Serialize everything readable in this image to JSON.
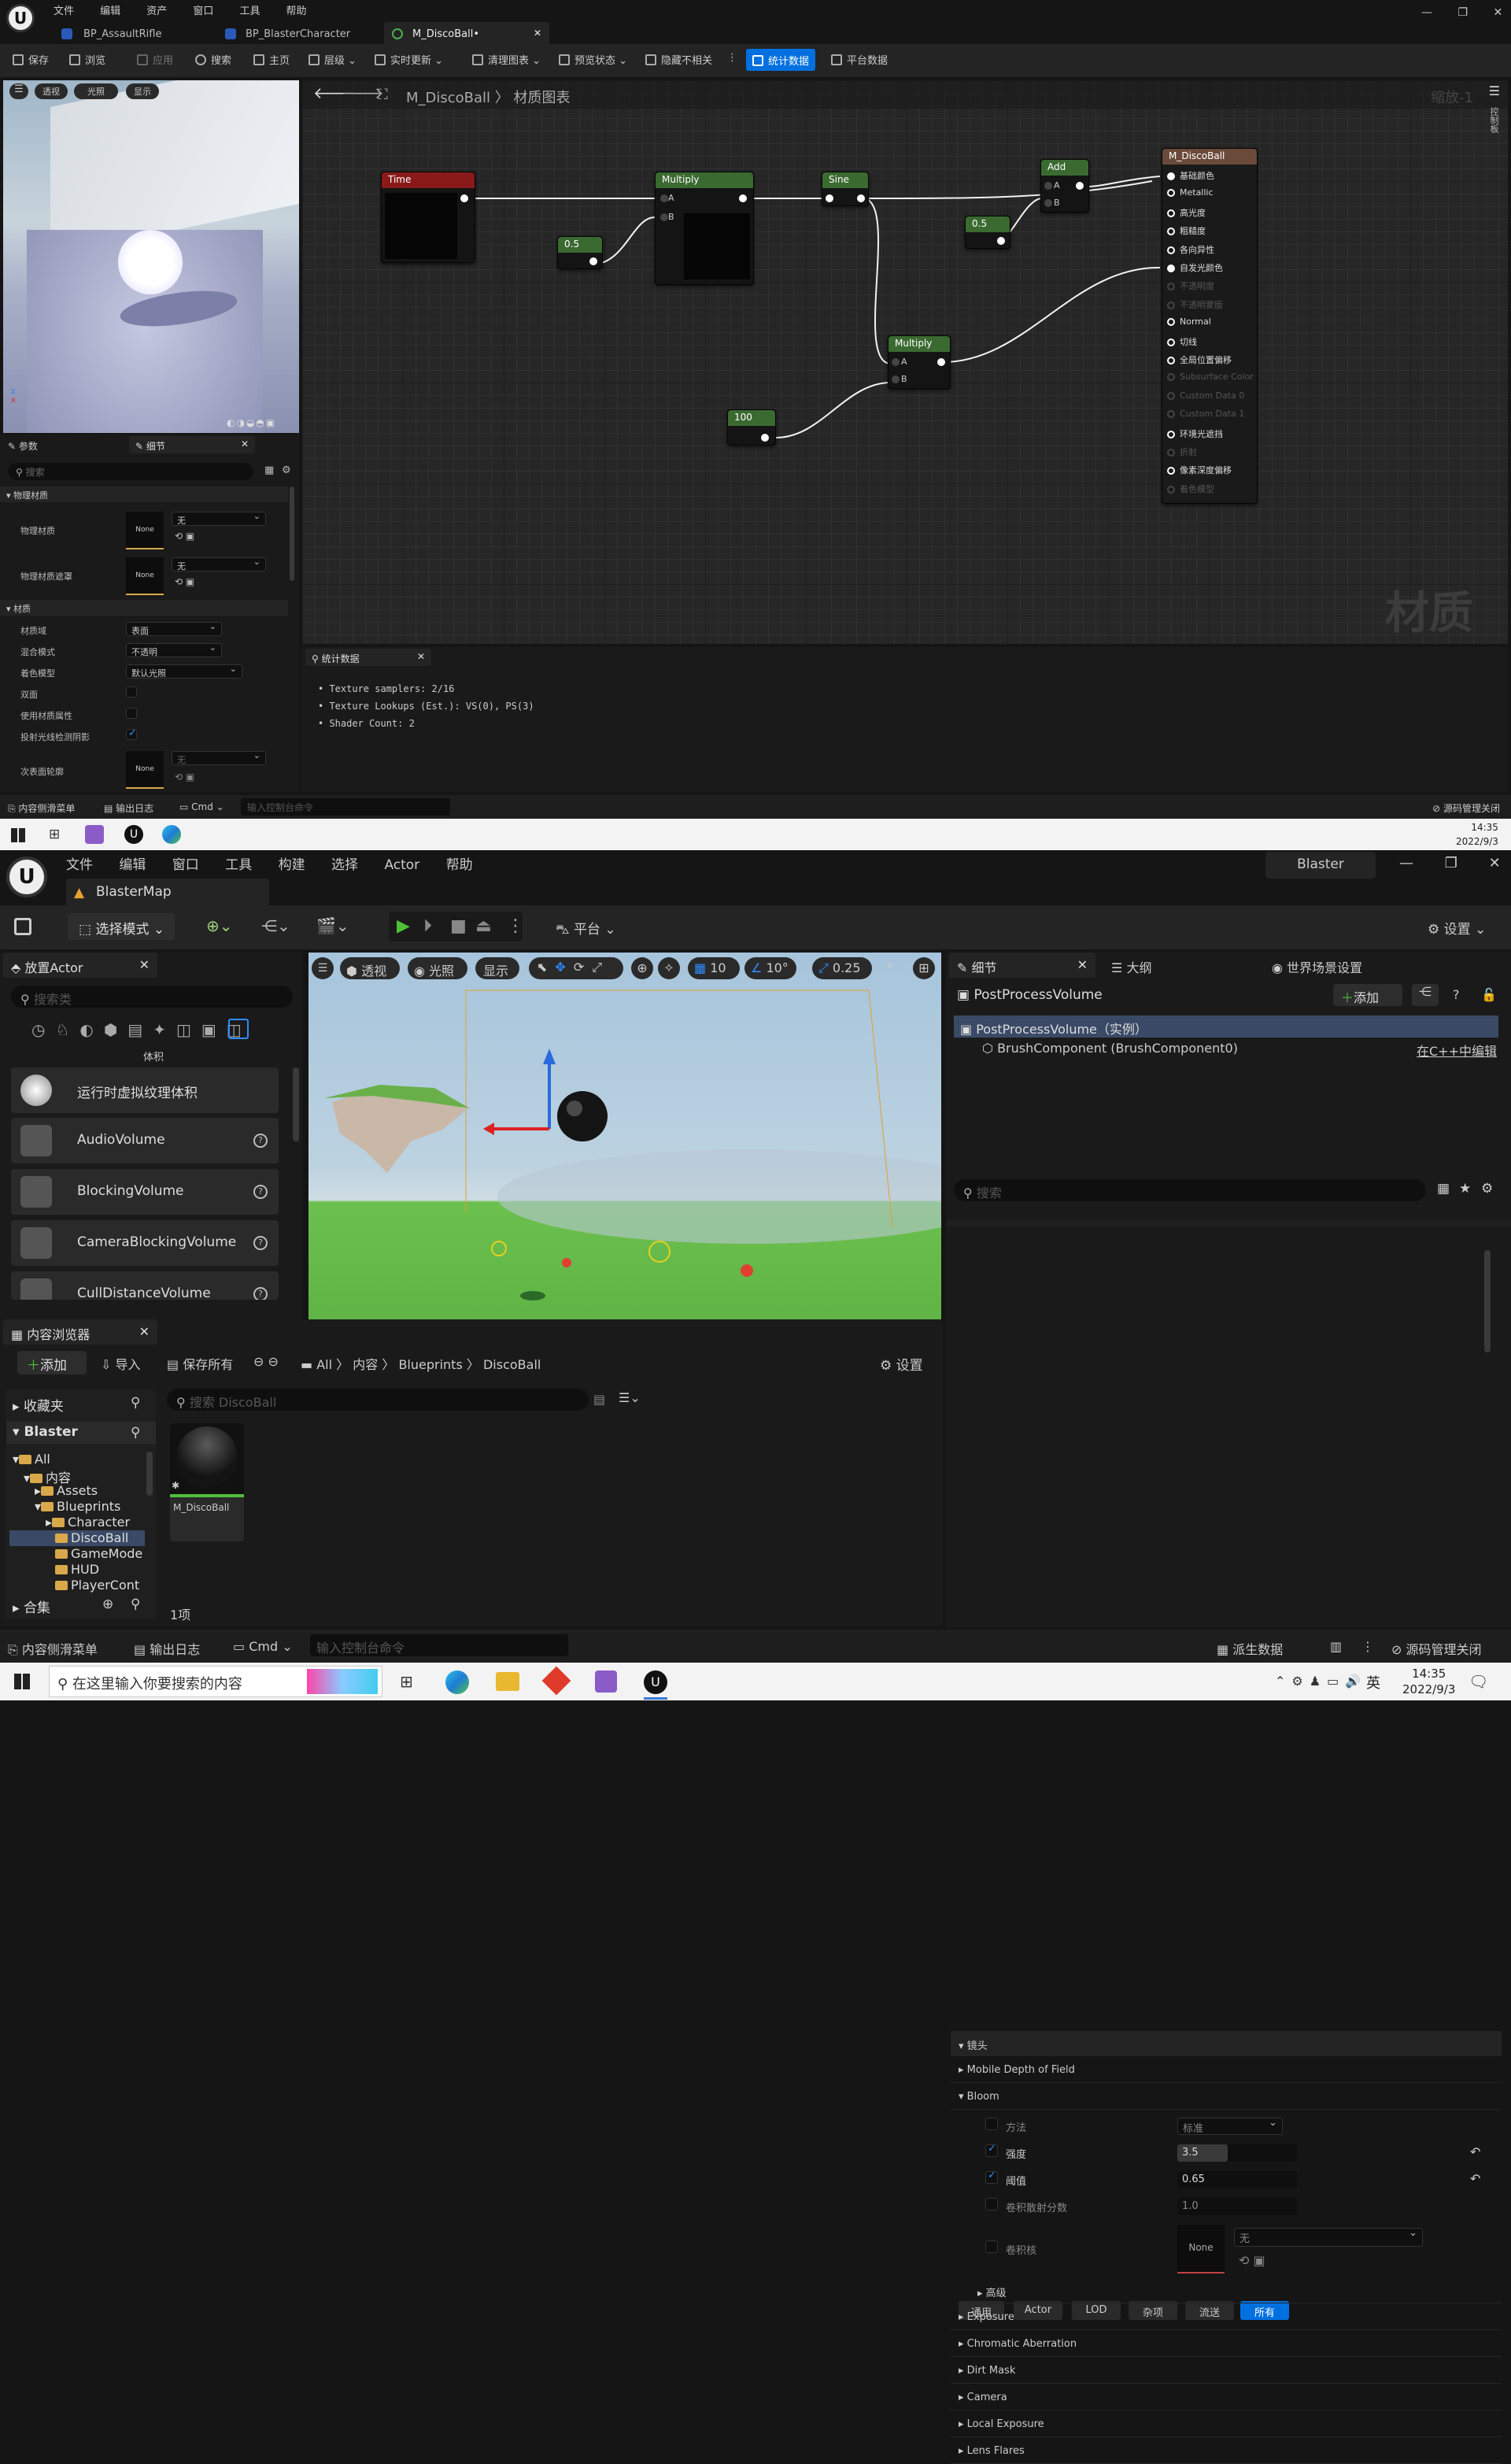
{
  "top": {
    "menu": [
      "文件",
      "编辑",
      "资产",
      "窗口",
      "工具",
      "帮助"
    ],
    "tabs": [
      "BP_AssaultRifle",
      "BP_BlasterCharacter",
      "M_DiscoBall•"
    ],
    "toolbar": [
      "保存",
      "浏览",
      "应用",
      "搜索",
      "主页",
      "层级",
      "实时更新",
      "清理图表",
      "预览状态",
      "隐藏不相关",
      "统计数据",
      "平台数据"
    ],
    "viewport_buttons": [
      "透视",
      "光照",
      "显示"
    ],
    "breadcrumb": {
      "asset": "M_DiscoBall",
      "graph": "材质图表"
    },
    "zoom": "缩放-1",
    "side_label": "控制板",
    "watermark": "材质",
    "nodes": {
      "time": "Time",
      "multiply1": "Multiply",
      "sine": "Sine",
      "add": "Add",
      "const1": "0.5",
      "const2": "0.5",
      "const3": "100",
      "multiply2": "Multiply",
      "pin_a": "A",
      "pin_b": "B",
      "result": "M_DiscoBall",
      "result_pins": [
        "基础颜色",
        "Metallic",
        "高光度",
        "粗糙度",
        "各向异性",
        "自发光颜色",
        "不透明度",
        "不透明蒙版",
        "Normal",
        "切线",
        "全局位置偏移",
        "Subsurface Color",
        "Custom Data 0",
        "Custom Data 1",
        "环境光遮挡",
        "折射",
        "像素深度偏移",
        "着色模型"
      ]
    },
    "details": {
      "tabs": [
        "参数",
        "细节"
      ],
      "search_placeholder": "搜索",
      "section_physical": "物理材质",
      "phys_material": "物理材质",
      "phys_mask": "物理材质遮罩",
      "none": "None",
      "combo_none": "无",
      "section_material": "材质",
      "material_domain": "材质域",
      "material_domain_value": "表面",
      "blend_mode": "混合模式",
      "blend_mode_value": "不透明",
      "shading_model": "着色模型",
      "shading_model_value": "默认光照",
      "two_sided": "双面",
      "use_material_attributes": "使用材质属性",
      "cast_ray_traced_shadows": "投射光线检测阴影",
      "subsurface_profile": "次表面轮廓"
    },
    "stats": {
      "tab": "统计数据",
      "lines": [
        "Texture samplers: 2/16",
        "Texture Lookups (Est.): VS(0), PS(3)",
        "Shader Count: 2"
      ]
    },
    "statusbar": {
      "content_drawer": "内容侧滑菜单",
      "output_log": "输出日志",
      "cmd": "Cmd",
      "console_placeholder": "输入控制台命令",
      "source_control": "源码管理关闭"
    }
  },
  "taskbar1": {
    "time": "14:35",
    "date": "2022/9/3"
  },
  "bottom": {
    "menu": [
      "文件",
      "编辑",
      "窗口",
      "工具",
      "构建",
      "选择",
      "Actor",
      "帮助"
    ],
    "project": "Blaster",
    "map_tab": "BlasterMap",
    "select_mode": "选择模式",
    "platform": "平台",
    "settings": "设置",
    "place_actor": {
      "tab": "放置Actor",
      "search_placeholder": "搜索类",
      "category": "体积",
      "items": [
        "运行时虚拟纹理体积",
        "AudioVolume",
        "BlockingVolume",
        "CameraBlockingVolume",
        "CullDistanceVolume"
      ]
    },
    "viewport": {
      "perspective": "透视",
      "lit": "光照",
      "show": "显示",
      "grid": "10",
      "rot": "10°",
      "scale": "0.25"
    },
    "details": {
      "tabs": [
        "细节",
        "大纲",
        "世界场景设置"
      ],
      "actor": "PostProcessVolume",
      "add": "添加",
      "instance": "PostProcessVolume（实例）",
      "component": "BrushComponent (BrushComponent0)",
      "edit_cpp": "在C++中编辑",
      "search_placeholder": "搜索",
      "filters": [
        "通用",
        "Actor",
        "LOD",
        "杂项",
        "流送",
        "所有"
      ],
      "lens": "镜头",
      "sections": [
        "Mobile Depth of Field",
        "Bloom"
      ],
      "bloom": {
        "method": "方法",
        "method_value": "标准",
        "intensity": "强度",
        "intensity_value": "3.5",
        "threshold": "阈值",
        "threshold_value": "0.65",
        "size_scale": "卷积散射分数",
        "size_scale_value": "1.0",
        "kernel": "卷积核",
        "kernel_none": "None",
        "kernel_combo": "无",
        "advanced": "高级"
      },
      "more_sections": [
        "Exposure",
        "Chromatic Aberration",
        "Dirt Mask",
        "Camera",
        "Local Exposure",
        "Lens Flares"
      ]
    },
    "content_browser": {
      "tab": "内容浏览器",
      "add": "添加",
      "import": "导入",
      "save_all": "保存所有",
      "path": [
        "All",
        "内容",
        "Blueprints",
        "DiscoBall"
      ],
      "settings": "设置",
      "favorites": "收藏夹",
      "project": "Blaster",
      "tree": [
        "All",
        "内容",
        "Assets",
        "Blueprints",
        "Character",
        "DiscoBall",
        "GameMode",
        "HUD",
        "PlayerCont"
      ],
      "collections": "合集",
      "search_placeholder": "搜索 DiscoBall",
      "asset": "M_DiscoBall",
      "count": "1项"
    },
    "statusbar": {
      "content_drawer": "内容侧滑菜单",
      "output_log": "输出日志",
      "cmd": "Cmd",
      "console_placeholder": "输入控制台命令",
      "derived_data": "派生数据",
      "source_control": "源码管理关闭"
    }
  },
  "taskbar2": {
    "search_placeholder": "在这里输入你要搜索的内容",
    "ime": "英",
    "time": "14:35",
    "date": "2022/9/3"
  },
  "colors": {
    "accent": "#0070e0",
    "time_node": "#8a1a1a",
    "math_node": "#3a6a30",
    "result_node": "#6a4a3a",
    "grass": "#5fb44a",
    "sky": "#a9c6dc"
  }
}
